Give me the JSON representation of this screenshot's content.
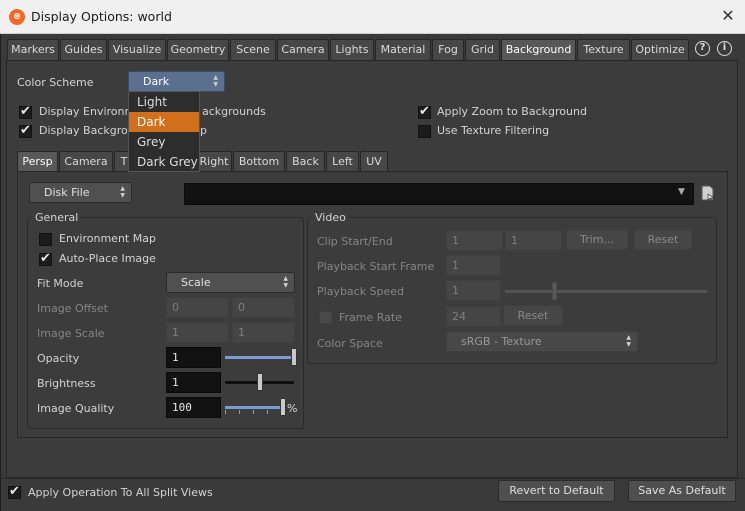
{
  "window": {
    "title": "Display Options:  world",
    "app_icon": "houdini-icon",
    "close_glyph": "✕"
  },
  "top_tabs": [
    "Markers",
    "Guides",
    "Visualize",
    "Geometry",
    "Scene",
    "Camera",
    "Lights",
    "Material",
    "Fog",
    "Grid",
    "Background",
    "Texture",
    "Optimize"
  ],
  "active_top_tab": "Background",
  "help_glyphs": {
    "help": "?",
    "info": "i"
  },
  "color_scheme": {
    "label": "Color Scheme",
    "value": "Dark",
    "options": [
      "Light",
      "Dark",
      "Grey",
      "Dark Grey"
    ],
    "highlighted": "Dark"
  },
  "checkboxes": {
    "display_env_text_left": "Display Environme",
    "display_env_text_right": "ackgrounds",
    "display_bg_text_left": "Display Backgrou",
    "display_bg_text_right": "p",
    "apply_zoom": "Apply Zoom to Background",
    "texture_filtering": "Use Texture Filtering"
  },
  "view_tabs": [
    "Persp",
    "Camera",
    "T",
    "Right",
    "Bottom",
    "Back",
    "Left",
    "UV"
  ],
  "active_view_tab": "Persp",
  "source": {
    "value": "Disk File",
    "path": ""
  },
  "general": {
    "title": "General",
    "env_map": "Environment Map",
    "auto_place": "Auto-Place Image",
    "fit_mode_label": "Fit Mode",
    "fit_mode_value": "Scale",
    "image_offset_label": "Image Offset",
    "image_offset": [
      "0",
      "0"
    ],
    "image_scale_label": "Image Scale",
    "image_scale": [
      "1",
      "1"
    ],
    "opacity_label": "Opacity",
    "opacity_value": "1",
    "opacity_level": 1.0,
    "brightness_label": "Brightness",
    "brightness_value": "1",
    "brightness_level": 0.5,
    "quality_label": "Image Quality",
    "quality_value": "100",
    "quality_unit": "%",
    "quality_level": 1.0
  },
  "video": {
    "title": "Video",
    "clip_label": "Clip Start/End",
    "clip_values": [
      "1",
      "1"
    ],
    "trim_button": "Trim...",
    "reset_button": "Reset",
    "playback_start_label": "Playback Start Frame",
    "playback_start": "1",
    "playback_speed_label": "Playback Speed",
    "playback_speed": "1",
    "frame_rate_label": "Frame Rate",
    "frame_rate": "24",
    "frame_rate_reset": "Reset",
    "color_space_label": "Color Space",
    "color_space": "sRGB - Texture"
  },
  "footer": {
    "apply_all": "Apply Operation To All Split Views",
    "revert_button": "Revert to Default",
    "save_button": "Save As Default"
  },
  "colors": {
    "accent_highlight": "#d36e1a",
    "selected_combo": "#5b6f8e",
    "slider_fill": "#7a9cd6"
  }
}
